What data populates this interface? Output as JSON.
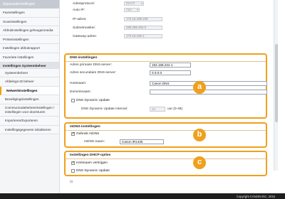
{
  "sidebar": {
    "header": "Apparaatinstellingen",
    "items": [
      {
        "label": "Faxinstellingen"
      },
      {
        "label": "Scaninstellingen"
      },
      {
        "label": "Afdrukinstellingen geheugenmedia"
      },
      {
        "label": "Printerinstellingen"
      },
      {
        "label": "Instellingen afdrukrapport"
      },
      {
        "label": "Favoriete instellingen"
      }
    ],
    "section": "Instellingen Systeembeheer",
    "sub_items": [
      {
        "label": "Systeembeheer"
      },
      {
        "label": "Afdelings-ID beheer"
      },
      {
        "label": "Netwerkinstellingen"
      },
      {
        "label": "Beveiligingsinstellingen"
      },
      {
        "label": "Communicatiebeheerinstellingen / instellingen voor doorsturen"
      },
      {
        "label": "Importeren/Exporteren"
      },
      {
        "label": "Instellingsgegevens initialiseren"
      }
    ]
  },
  "top": {
    "address_protocol_label": "Adresprotocol:",
    "address_protocol_value": "DHCP",
    "auto_ip_label": "Auto IP:",
    "auto_ip_value": "Aan",
    "ip_label": "IP-adres:",
    "ip_value": "172.16.199.239",
    "subnet_label": "Subnetmasker:",
    "subnet_value": "255.255.252.0",
    "gateway_label": "Gateway-adres:",
    "gateway_value": "172.16.196.1"
  },
  "dns": {
    "title": "DNS-instellingen",
    "primary_label": "Adres primaire DNS-server:",
    "primary_value": "192.168.222.1",
    "secondary_label": "Adres secundaire DNS-server:",
    "secondary_value": "0.0.0.0",
    "hostname_label": "Hostnaam:",
    "hostname_value": "Canon DNS",
    "domain_label": "Domeinnaam:",
    "domain_value": "",
    "dynamic_update_label": "DNS Dynamic Update",
    "interval_label": "DNS Dynamic Update interval:",
    "interval_value": "24",
    "interval_unit": "uur (0-48)"
  },
  "mdns": {
    "title": "mDNS-instellingen",
    "use_label": "Gebruik mDNS",
    "name_label": "mDNS-naam:",
    "name_value": "Canon iR1435"
  },
  "dhcp": {
    "title": "Instellingen DHCP-opties",
    "hostname_label": "Hostnaam verkrijgen",
    "dynamic_update_label": "DNS Dynamic Update"
  },
  "badges": {
    "a": "a",
    "b": "b",
    "c": "c"
  },
  "footer": {
    "copyright": "Copyright CANON INC. 2015"
  },
  "colors": {
    "accent": "#f0a01c",
    "footer_bg": "#1e1e1e"
  }
}
